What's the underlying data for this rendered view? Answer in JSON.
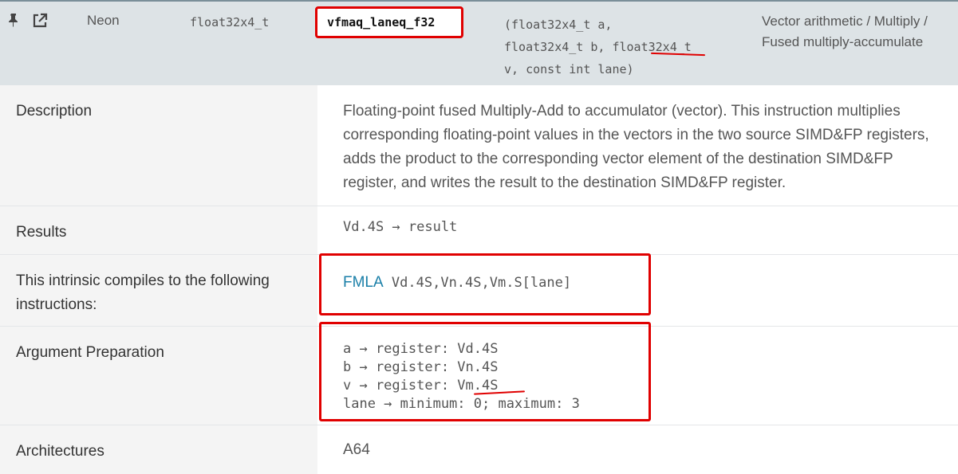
{
  "header": {
    "pin_icon": "pin-icon",
    "external_link_icon": "external-link-icon",
    "isa": "Neon",
    "return_type": "float32x4_t",
    "name": "vfmaq_laneq_f32",
    "signature_line1": "(float32x4_t a,",
    "signature_line2a": "float32x4_t b, ",
    "signature_line2b": "float32x4_t",
    "signature_line3": "v, const int lane)",
    "category_line1": "Vector arithmetic / Multiply /",
    "category_line2": "Fused multiply-accumulate"
  },
  "rows": {
    "description": {
      "label": "Description",
      "value": "Floating-point fused Multiply-Add to accumulator (vector). This instruction multiplies corresponding floating-point values in the vectors in the two source SIMD&FP registers, adds the product to the corresponding vector element of the destination SIMD&FP register, and writes the result to the destination SIMD&FP register."
    },
    "results": {
      "label": "Results",
      "value": "Vd.4S → result"
    },
    "instructions": {
      "label_line1": "This intrinsic compiles to the following",
      "label_line2": "instructions:",
      "mnemonic": "FMLA",
      "operands": " Vd.4S,Vn.4S,Vm.S[lane]"
    },
    "arguments": {
      "label": "Argument Preparation",
      "line1": "a → register: Vd.4S",
      "line2": "b → register: Vn.4S",
      "line3": "v → register: Vm.4S",
      "line4": "lane → minimum: 0; maximum: 3"
    },
    "architectures": {
      "label": "Architectures",
      "value": "A64"
    }
  },
  "colors": {
    "annotation_red": "#e00000",
    "header_bg": "#dde3e6",
    "label_bg": "#f4f4f4",
    "mnemonic_link": "#1a7fa8"
  }
}
